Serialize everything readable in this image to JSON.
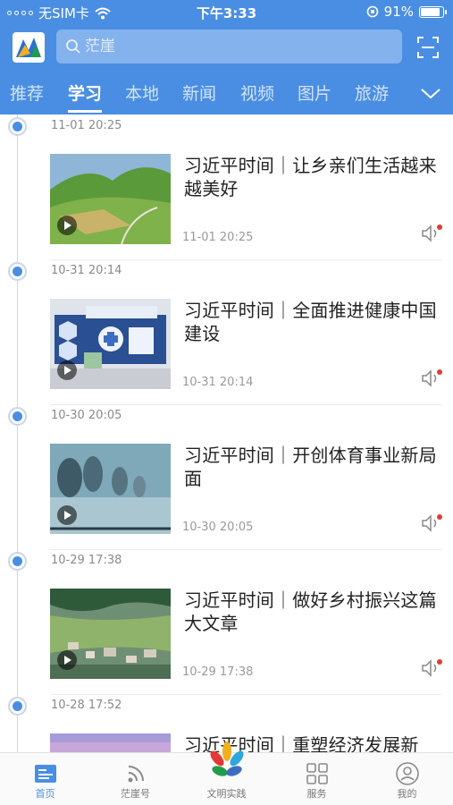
{
  "status_bar": {
    "carrier": "无SIM卡",
    "time": "下午3:33",
    "battery": "91%",
    "battery_level": 0.91
  },
  "header": {
    "search_placeholder": "茫崖",
    "tabs": [
      {
        "label": "推荐",
        "active": false
      },
      {
        "label": "学习",
        "active": true
      },
      {
        "label": "本地",
        "active": false
      },
      {
        "label": "新闻",
        "active": false
      },
      {
        "label": "视频",
        "active": false
      },
      {
        "label": "图片",
        "active": false
      },
      {
        "label": "旅游",
        "active": false
      }
    ]
  },
  "feed": [
    {
      "time": "11-01 20:25",
      "title": "习近平时间｜让乡亲们生活越来越美好",
      "date": "11-01 20:25"
    },
    {
      "time": "10-31 20:14",
      "title": "习近平时间｜全面推进健康中国建设",
      "date": "10-31 20:14"
    },
    {
      "time": "10-30 20:05",
      "title": "习近平时间｜开创体育事业新局面",
      "date": "10-30 20:05"
    },
    {
      "time": "10-29 17:38",
      "title": "习近平时间｜做好乡村振兴这篇大文章",
      "date": "10-29 17:38"
    },
    {
      "time": "10-28 17:52",
      "title": "习近平时间｜重塑经济发展新",
      "date": ""
    }
  ],
  "bottom_nav": [
    {
      "label": "首页",
      "icon": "home-icon",
      "active": true
    },
    {
      "label": "茫崖号",
      "icon": "rss-icon",
      "active": false
    },
    {
      "label": "文明实践",
      "icon": "petal-logo-icon",
      "active": false
    },
    {
      "label": "服务",
      "icon": "grid-icon",
      "active": false
    },
    {
      "label": "我的",
      "icon": "user-icon",
      "active": false
    }
  ],
  "colors": {
    "brand": "#4a8ee3",
    "timeline_dot": "#4a8ee3",
    "badge": "#e53935"
  }
}
